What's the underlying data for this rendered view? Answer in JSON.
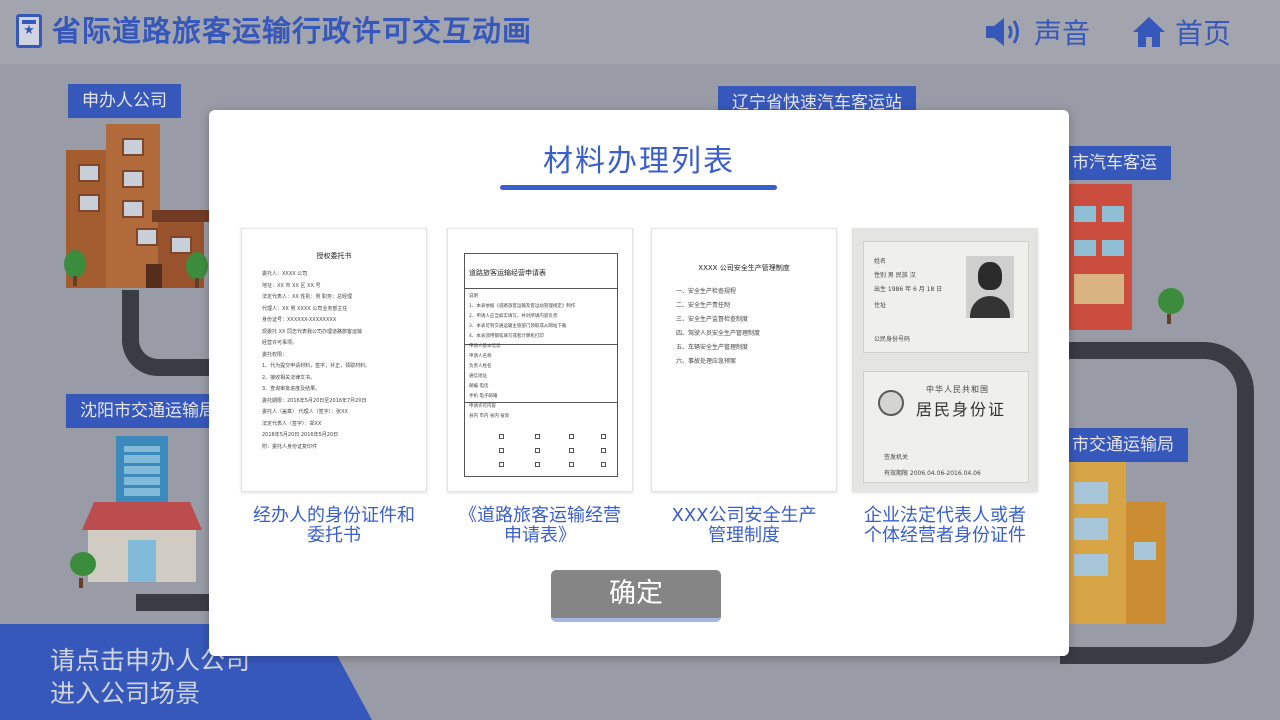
{
  "header": {
    "title": "省际道路旅客运输行政许可交互动画",
    "sound_label": "声音",
    "home_label": "首页"
  },
  "scene": {
    "labels": [
      "申办人公司",
      "辽宁省快速汽车客运站",
      "市汽车客运",
      "沈阳市交通运输局",
      "市交通运输局"
    ],
    "hint": "请点击申办人公司\n进入公司场景"
  },
  "modal": {
    "title": "材料办理列表",
    "confirm_label": "确定",
    "items": [
      {
        "caption": "经办人的身份证件和\n委托书",
        "doc_title": "授权委托书",
        "doc_text": "委托人：XXXX 公司\n地址：XX 市 XX 区 XX 号\n法定代表人：XX  性别：男  职务：总经理\n代理人：XX  男  XXXX 公司业务部主任\n身份证号：XXXXXX-XXXXXXXX\n现委托 XX 同志代表我公司办理道路旅客运输\n经营许可事项。\n委托权限：\n1、代为提交申请材料，签字，补正，领取材料。\n2、接收相关法律文书。\n3、查询审批进度及结果。\n委托期限：2016年5月20日至2016年7月20日\n委托人（盖章）       代理人（签字）：张XX\n法定代表人（签字）：郑XX\n2016年5月20日       2016年5月20日\n附：委托人身份证复印件"
      },
      {
        "caption": "《道路旅客运输经营\n申请表》",
        "doc_title": "道路旅客运输经营申请表",
        "doc_text": "说明\n1、本表依据《道路旅客运输及客运站管理规定》制作\n2、申请人应当如实填写，并对所填内容负责\n3、本表可到交通运输主管部门领取或从网站下载\n4、本表须用钢笔填写或者计算机打印\n申请人基本信息\n申请人名称\n负责人姓名\n通信地址\n邮编   电话\n手机   电子邮箱\n申请许可内容\n县内  市内  省内  省际"
      },
      {
        "caption": "XXX公司安全生产\n管理制度",
        "doc_title": "XXXX 公司安全生产管理制度",
        "doc_text": "一、安全生产检查规程\n二、安全生产责任制\n三、安全生产监督检查制度\n四、驾驶人员安全生产管理制度\n五、车辆安全生产管理制度\n六、事故处理应急预案"
      },
      {
        "caption": "企业法定代表人或者\n个体经营者身份证件",
        "id_front_name": "姓名",
        "id_front_sex": "性别  男  民族  汉",
        "id_front_birth": "出生  1986 年 6 月 18 日",
        "id_front_addr": "住址",
        "id_front_number": "公民身份号码",
        "id_back_country": "中华人民共和国",
        "id_back_title": "居民身份证",
        "id_back_authority": "签发机关",
        "id_back_validity": "有效期限  2006.04.06-2016.04.06"
      }
    ]
  },
  "colors": {
    "accent": "#3a5fcd",
    "background": "#a9acb6",
    "button": "#858585",
    "road": "#3d3f45"
  },
  "icons": {
    "logo": "badge-star-icon",
    "sound": "speaker-icon",
    "home": "home-icon"
  }
}
